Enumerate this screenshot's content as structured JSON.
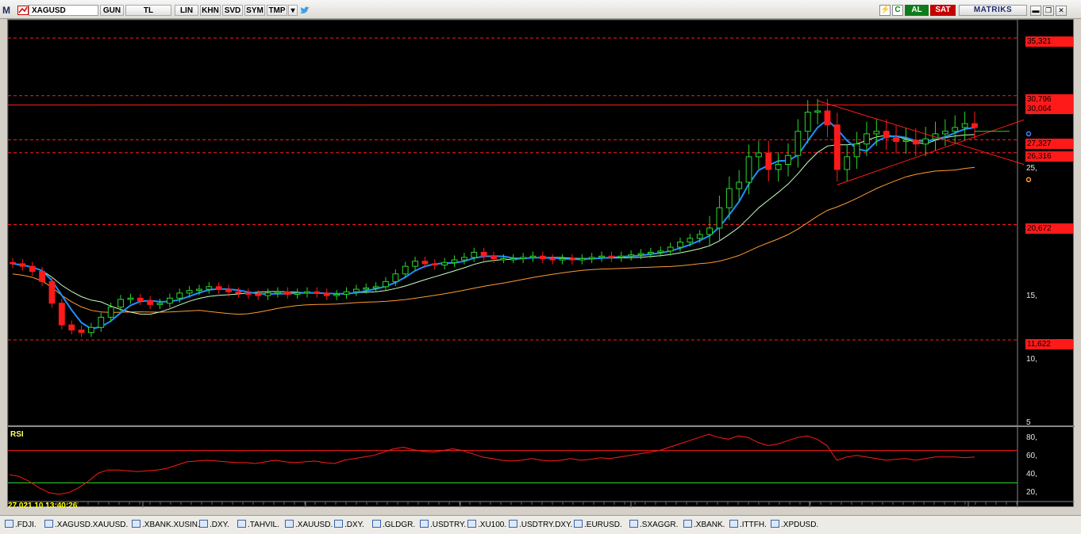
{
  "toolbar": {
    "logo": "M",
    "symbol": "XAGUSD",
    "buttons": [
      "GUN",
      "TL",
      "LIN",
      "KHN",
      "SVD",
      "SYM",
      "TMP"
    ],
    "buy_label": "AL",
    "sell_label": "SAT",
    "brand": "MATRIKS"
  },
  "price_axis": {
    "ticks": [
      "25,",
      "15,",
      "10,",
      "5"
    ]
  },
  "price_labels": [
    "35,321",
    "30,796",
    "30,064",
    "27,327",
    "26,316",
    "20,672",
    "11,622"
  ],
  "rsi": {
    "title": "RSI",
    "ticks": [
      "80,",
      "60,",
      "40,",
      "20,"
    ]
  },
  "date_strip": "27.021   10   13:40:26",
  "bottom_tabs": [
    ".FDJI.",
    ".XAGUSD.XAUUSD.",
    ".XBANK.XUSIN.",
    ".DXY.",
    ".TAHVIL.",
    ".XAUUSD.",
    ".DXY.",
    ".GLDGR.",
    ".USDTRY.",
    ".XU100.",
    ".USDTRY.DXY.",
    ".EURUSD.",
    ".SXAGGR.",
    ".XBANK.",
    ".ITTFH.",
    ".XPDUSD."
  ],
  "colors": {
    "background": "#000000",
    "up_candle": "#2bd62b",
    "down_candle": "#ff1a1a",
    "ma_fast": "#1e90ff",
    "ma_mid": "#c8ffc0",
    "ma_slow": "#ff9a30",
    "level_line": "#ff1a1a",
    "rsi_line": "#ff1a1a"
  },
  "chart_data": {
    "type": "candlestick",
    "symbol": "XAGUSD",
    "ylim": [
      5,
      37
    ],
    "horizontal_levels": [
      35.321,
      30.796,
      30.064,
      27.327,
      26.316,
      20.672,
      11.622
    ],
    "close": [
      17.6,
      17.4,
      17.0,
      16.2,
      14.5,
      12.8,
      12.4,
      12.2,
      12.6,
      13.4,
      14.2,
      14.8,
      14.9,
      14.7,
      14.4,
      14.5,
      14.9,
      15.3,
      15.5,
      15.6,
      15.8,
      15.6,
      15.4,
      15.3,
      15.2,
      15.1,
      15.3,
      15.4,
      15.2,
      15.3,
      15.4,
      15.3,
      15.1,
      15.2,
      15.4,
      15.6,
      15.7,
      15.8,
      16.2,
      16.8,
      17.4,
      17.8,
      17.6,
      17.5,
      17.7,
      17.9,
      18.1,
      18.5,
      18.2,
      18.0,
      18.0,
      18.0,
      18.1,
      18.2,
      18.0,
      17.9,
      18.0,
      17.9,
      18.0,
      18.1,
      18.2,
      18.1,
      18.2,
      18.3,
      18.4,
      18.5,
      18.6,
      18.9,
      19.3,
      19.6,
      19.9,
      20.4,
      22.0,
      23.5,
      24.0,
      26.0,
      26.3,
      25.0,
      25.4,
      26.1,
      28.0,
      29.5,
      29.6,
      28.5,
      25.0,
      26.0,
      27.0,
      27.8,
      28.0,
      27.5,
      27.2,
      27.3,
      27.0,
      27.4,
      27.8,
      28.0,
      28.3,
      28.6,
      28.3
    ],
    "ma_fast_end": 28.0,
    "ma_mid_end": 26.5,
    "ma_slow_end": 24.2,
    "rsi_values": [
      40,
      38,
      32,
      24,
      18,
      16,
      18,
      24,
      32,
      42,
      46,
      46,
      45,
      44,
      45,
      46,
      48,
      52,
      56,
      57,
      58,
      57,
      56,
      55,
      55,
      54,
      56,
      58,
      56,
      55,
      56,
      57,
      55,
      54,
      58,
      60,
      62,
      64,
      68,
      72,
      74,
      71,
      69,
      68,
      70,
      72,
      70,
      66,
      62,
      60,
      58,
      57,
      58,
      60,
      58,
      57,
      58,
      60,
      58,
      59,
      61,
      60,
      62,
      64,
      66,
      68,
      70,
      74,
      78,
      82,
      86,
      90,
      86,
      84,
      88,
      86,
      80,
      76,
      78,
      82,
      86,
      88,
      84,
      76,
      58,
      62,
      64,
      62,
      60,
      58,
      59,
      60,
      58,
      60,
      62,
      62,
      62,
      61,
      62
    ],
    "rsi_levels": [
      70,
      30
    ]
  }
}
